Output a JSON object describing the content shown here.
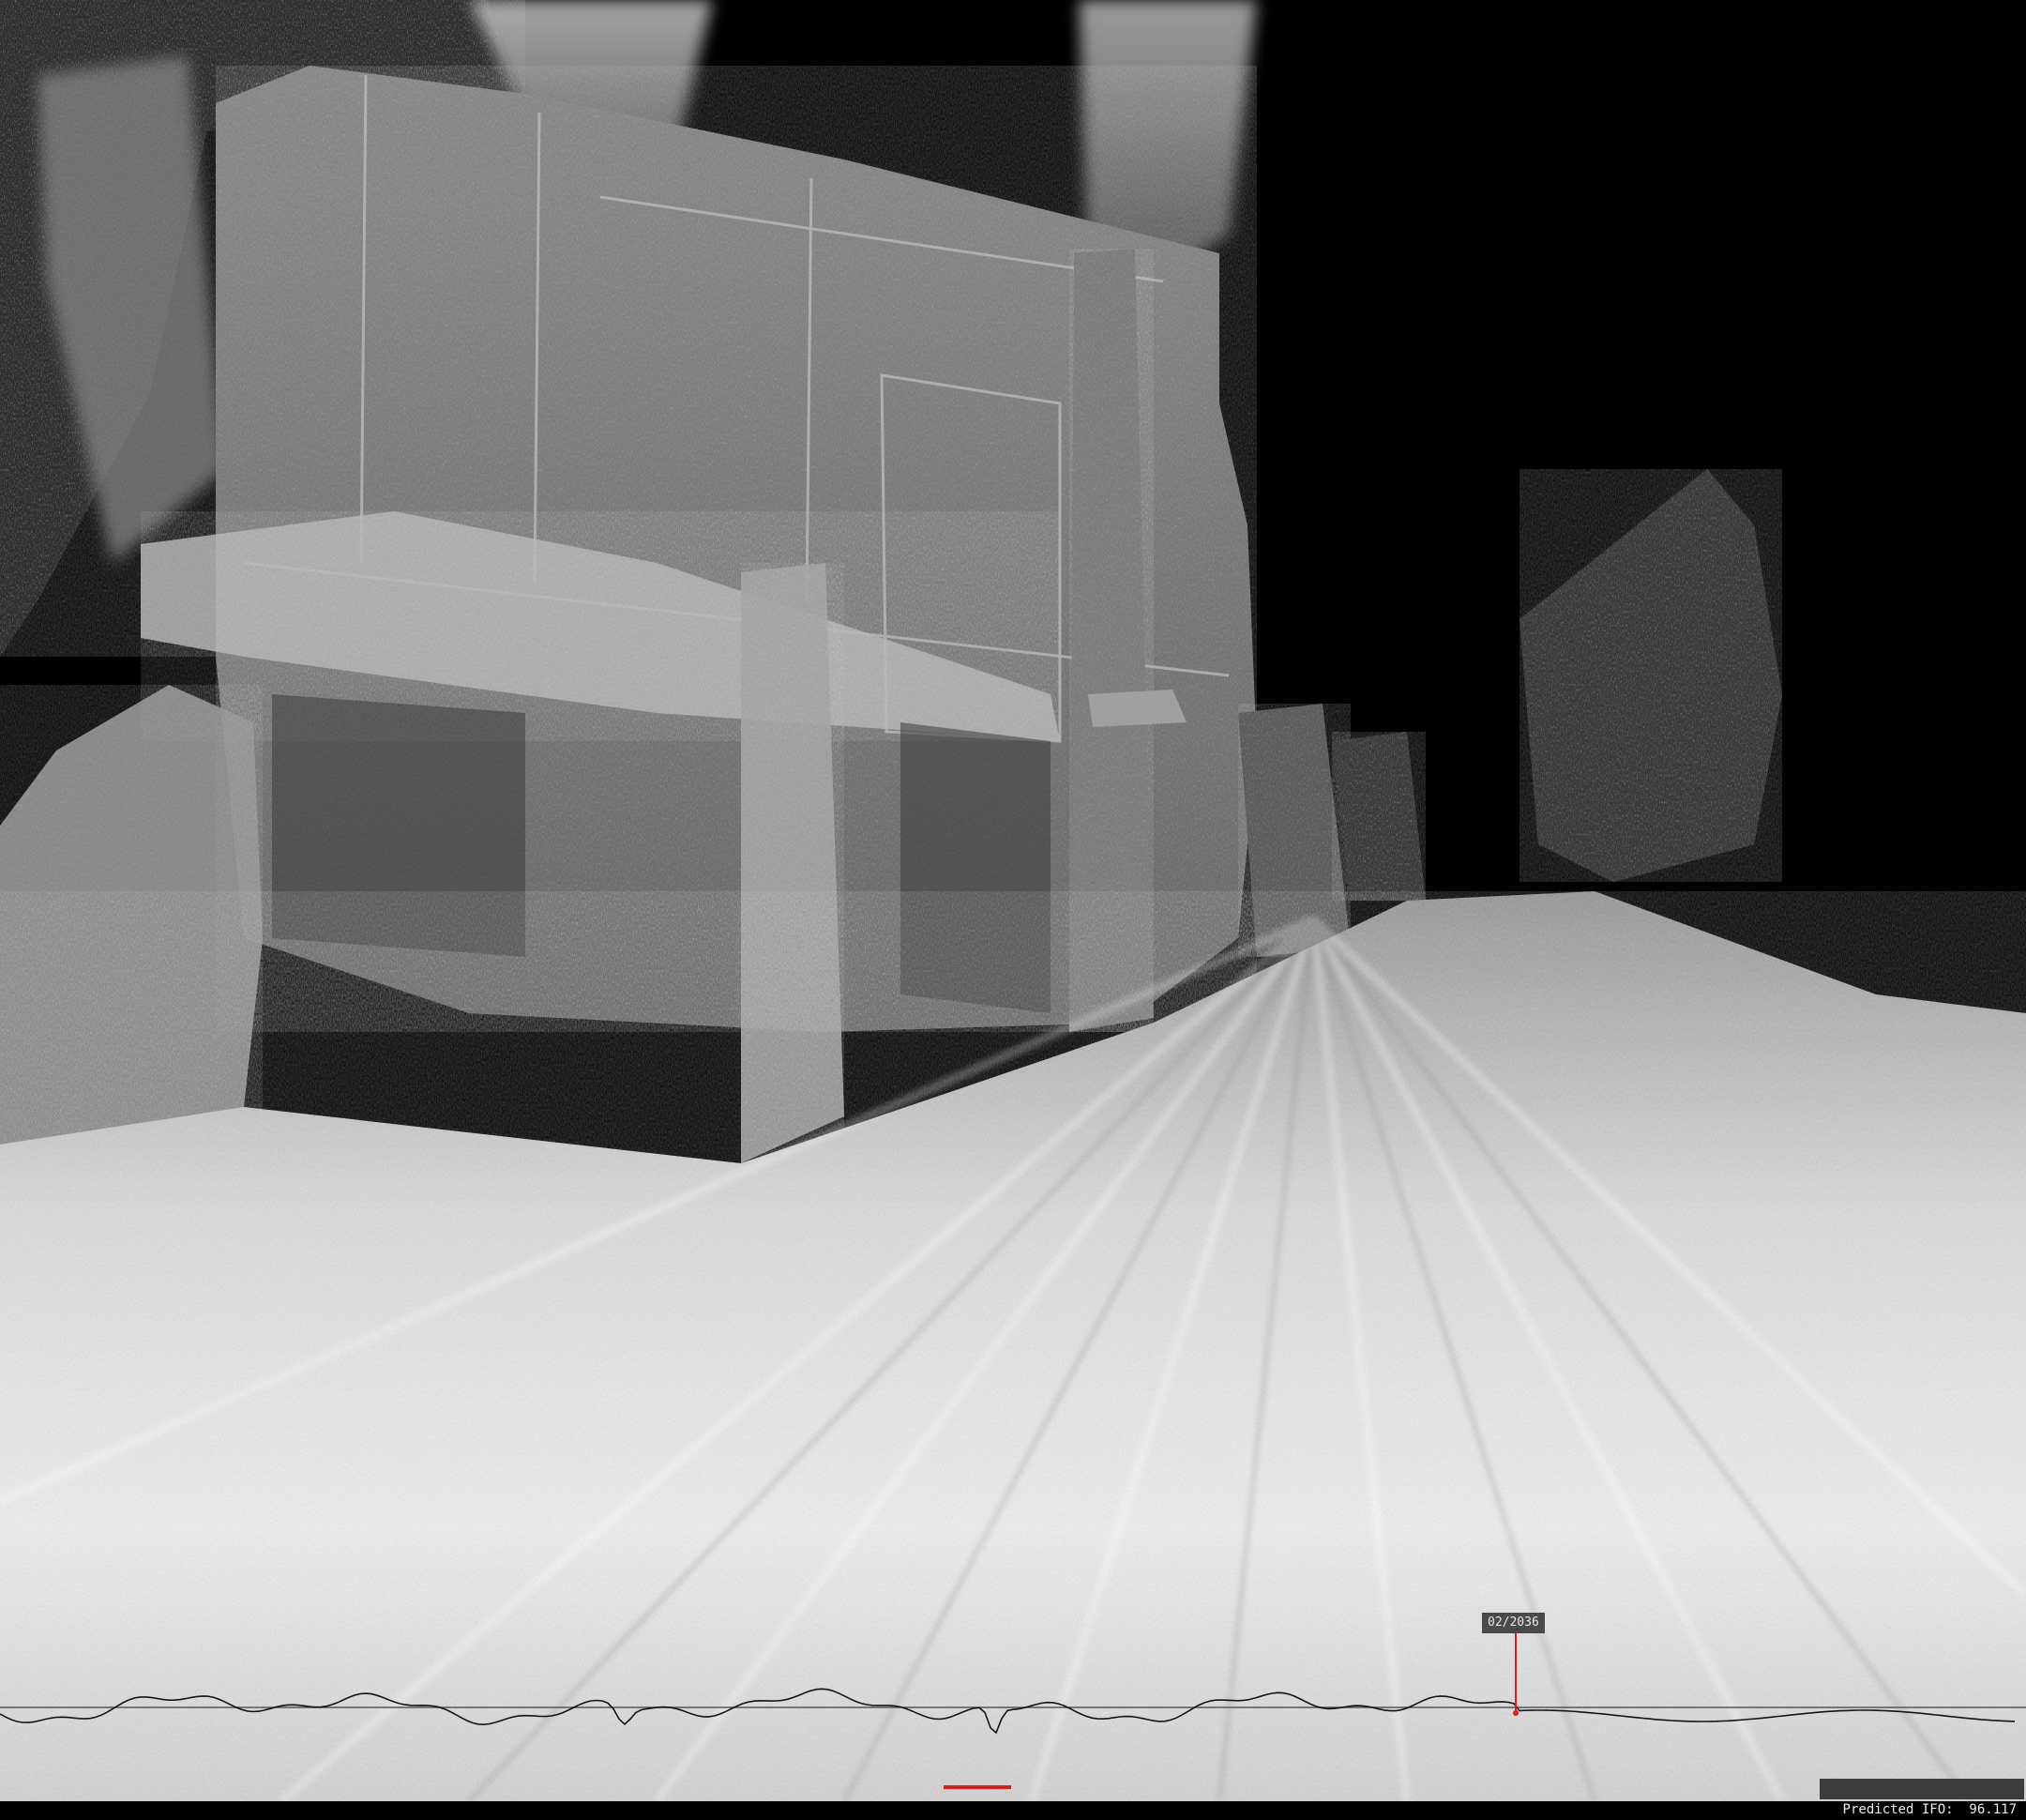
{
  "viewer": {
    "mode": "point-cloud",
    "background_color": "#000000"
  },
  "timeline": {
    "current_frame_label": "02/2036",
    "marker_color": "#e01b1b",
    "baseline_color": "#555555",
    "trace_color": "#141414"
  },
  "status": {
    "predicted_ifo_label": "Predicted IFO:",
    "predicted_ifo_value": "96.117"
  }
}
